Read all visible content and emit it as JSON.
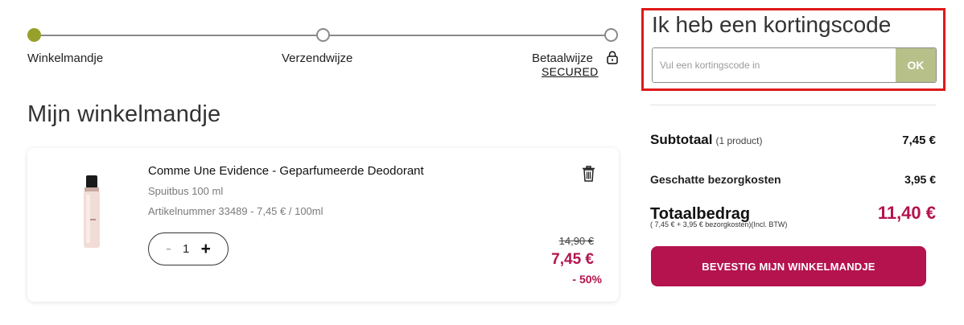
{
  "stepper": {
    "steps": [
      {
        "label": "Winkelmandje",
        "active": true
      },
      {
        "label": "Verzendwijze",
        "active": false
      },
      {
        "label": "Betaalwijze",
        "active": false
      }
    ],
    "secured_label": "SECURED"
  },
  "cart": {
    "title": "Mijn winkelmandje",
    "item": {
      "name": "Comme Une Evidence - Geparfumeerde Deodorant",
      "size": "Spuitbus 100 ml",
      "sku_line": "Artikelnummer 33489 - 7,45 € / 100ml",
      "quantity": "1",
      "minus_label": "-",
      "plus_label": "+",
      "old_price": "14,90 €",
      "price": "7,45 €",
      "discount": "- 50%"
    }
  },
  "coupon": {
    "title": "Ik heb een kortingscode",
    "placeholder": "Vul een kortingscode in",
    "button_label": "OK"
  },
  "summary": {
    "subtotal_label": "Subtotaal",
    "subtotal_sub": "(1 product)",
    "subtotal_value": "7,45 €",
    "shipping_label": "Geschatte bezorgkosten",
    "shipping_value": "3,95 €",
    "total_label": "Totaalbedrag",
    "total_note": "( 7,45 € + 3,95 € bezorgkosten)(Incl. BTW)",
    "total_value": "11,40 €",
    "confirm_label": "BEVESTIG MIJN WINKELMANDJE"
  },
  "colors": {
    "accent": "#b4134e",
    "step_active": "#97a02a",
    "ok_button": "#b8c08a",
    "highlight_border": "#e01919"
  },
  "icons": [
    "lock-icon",
    "trash-icon"
  ]
}
